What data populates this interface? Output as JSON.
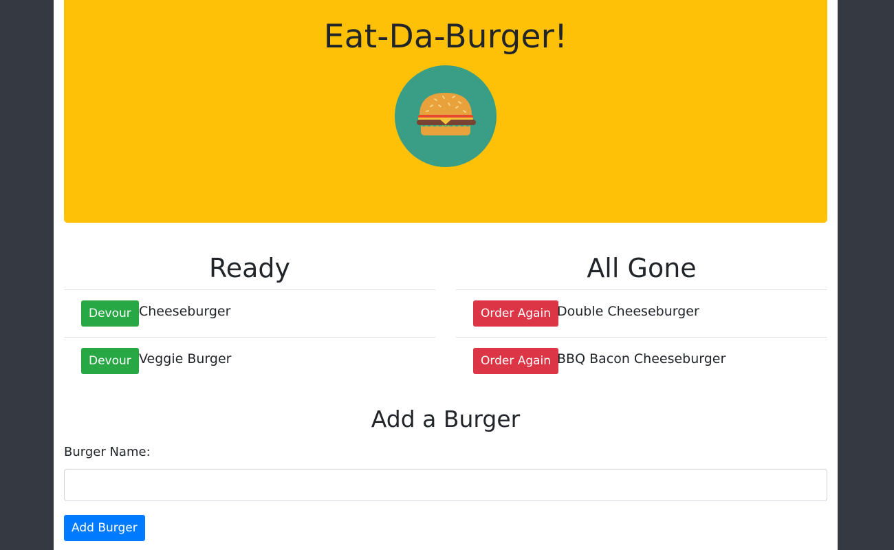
{
  "header": {
    "title": "Eat-Da-Burger!",
    "logo_icon": "burger-icon"
  },
  "ready": {
    "title": "Ready",
    "button_label": "Devour",
    "items": [
      {
        "name": "Cheeseburger"
      },
      {
        "name": "Veggie Burger"
      }
    ]
  },
  "gone": {
    "title": "All Gone",
    "button_label": "Order Again",
    "items": [
      {
        "name": "Double Cheeseburger"
      },
      {
        "name": "BBQ Bacon Cheeseburger"
      }
    ]
  },
  "form": {
    "title": "Add a Burger",
    "label": "Burger Name:",
    "input_value": "",
    "input_placeholder": "",
    "submit_label": "Add Burger"
  },
  "colors": {
    "page_background": "#343a40",
    "jumbotron": "#ffc107",
    "logo_circle": "#3a9d86",
    "success": "#28a745",
    "danger": "#dc3545",
    "primary": "#007bff"
  }
}
